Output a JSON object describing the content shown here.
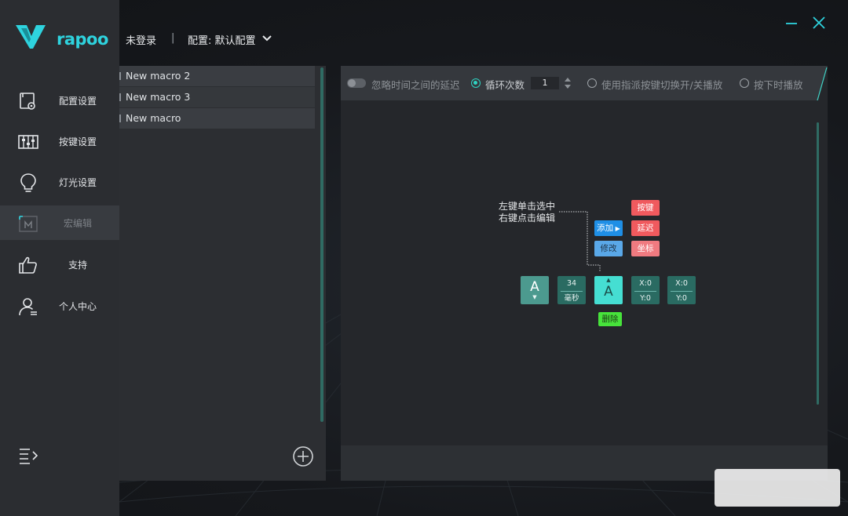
{
  "brand": {
    "logo_text": "rapoo",
    "accent": "#2ed3de"
  },
  "header": {
    "login_status": "未登录",
    "separator": "|",
    "config_label": "配置: 默认配置"
  },
  "sidebar": {
    "items": [
      {
        "label": "配置设置",
        "icon": "config-settings-icon"
      },
      {
        "label": "按键设置",
        "icon": "key-settings-icon"
      },
      {
        "label": "灯光设置",
        "icon": "lightbulb-icon"
      },
      {
        "label": "宏编辑",
        "icon": "macro-icon",
        "active": true
      },
      {
        "label": "支持",
        "icon": "thumbs-up-icon"
      },
      {
        "label": "个人中心",
        "icon": "user-icon"
      }
    ]
  },
  "macro_list": {
    "items": [
      "New macro 2",
      "New macro 3",
      "New macro"
    ]
  },
  "toolbar": {
    "ignore_delay_label": "忽略时间之间的延迟",
    "loop_label": "循环次数",
    "loop_count": "1",
    "toggle_play_label": "使用指派按键切换开/关播放",
    "hold_play_label": "按下时播放"
  },
  "guide": {
    "hint_line1": "左键单击选中",
    "hint_line2": "右键点击编辑",
    "add_label": "添加",
    "modify_label": "修改",
    "key_label": "按键",
    "delay_label": "延迟",
    "coord_label": "坐标",
    "delete_label": "删除",
    "key_node": "A",
    "delay_value": "34",
    "delay_unit": "毫秒",
    "coord_x": "X:0",
    "coord_y": "Y:0"
  }
}
